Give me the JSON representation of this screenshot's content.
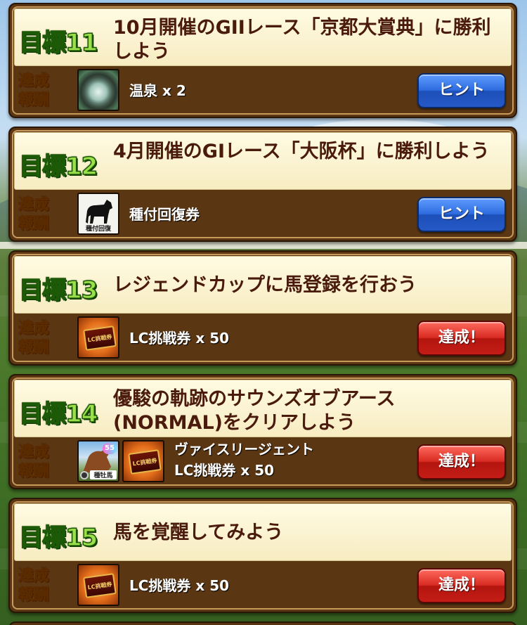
{
  "reward_label": "達成\n報酬",
  "goals": [
    {
      "badge": "目標11",
      "text": "10月開催のGIIレース「京都大賞典」に勝利しよう",
      "items": [
        {
          "icon": "hot-spring-icon",
          "label": "温泉 x 2"
        }
      ],
      "button": {
        "label": "ヒント",
        "kind": "hint"
      }
    },
    {
      "badge": "目標12",
      "text": "4月開催のGIレース「大阪杯」に勝利しよう",
      "items": [
        {
          "icon": "stud-recovery-ticket-icon",
          "label": "種付回復券",
          "icon_caption": "種付回復"
        }
      ],
      "button": {
        "label": "ヒント",
        "kind": "hint"
      }
    },
    {
      "badge": "目標13",
      "text": "レジェンドカップに馬登録を行おう",
      "items": [
        {
          "icon": "lc-ticket-icon",
          "label": "LC挑戦券 x 50",
          "icon_caption": "LC挑戦券"
        }
      ],
      "button": {
        "label": "達成！",
        "kind": "done"
      }
    },
    {
      "badge": "目標14",
      "text": "優駿の軌跡のサウンズオブアース(NORMAL)をクリアしよう",
      "items": [
        {
          "icon": "stallion-card-icon",
          "label": "ヴァイスリージェント",
          "icon_caption": "種牡馬",
          "icon_badge": "55"
        },
        {
          "icon": "lc-ticket-icon",
          "label": "LC挑戦券 x 50",
          "icon_caption": "LC挑戦券"
        }
      ],
      "button": {
        "label": "達成！",
        "kind": "done"
      }
    },
    {
      "badge": "目標15",
      "text": "馬を覚醒してみよう",
      "items": [
        {
          "icon": "lc-ticket-icon",
          "label": "LC挑戦券 x 50",
          "icon_caption": "LC挑戦券"
        }
      ],
      "button": {
        "label": "達成！",
        "kind": "done"
      }
    }
  ],
  "colors": {
    "goal_badge": "#9be04a",
    "goal_text": "#4a1a0c",
    "reward_label": "#ffd24a",
    "hint_button": "#2f6de0",
    "done_button": "#d92c22",
    "card_frame": "#5a3613"
  }
}
